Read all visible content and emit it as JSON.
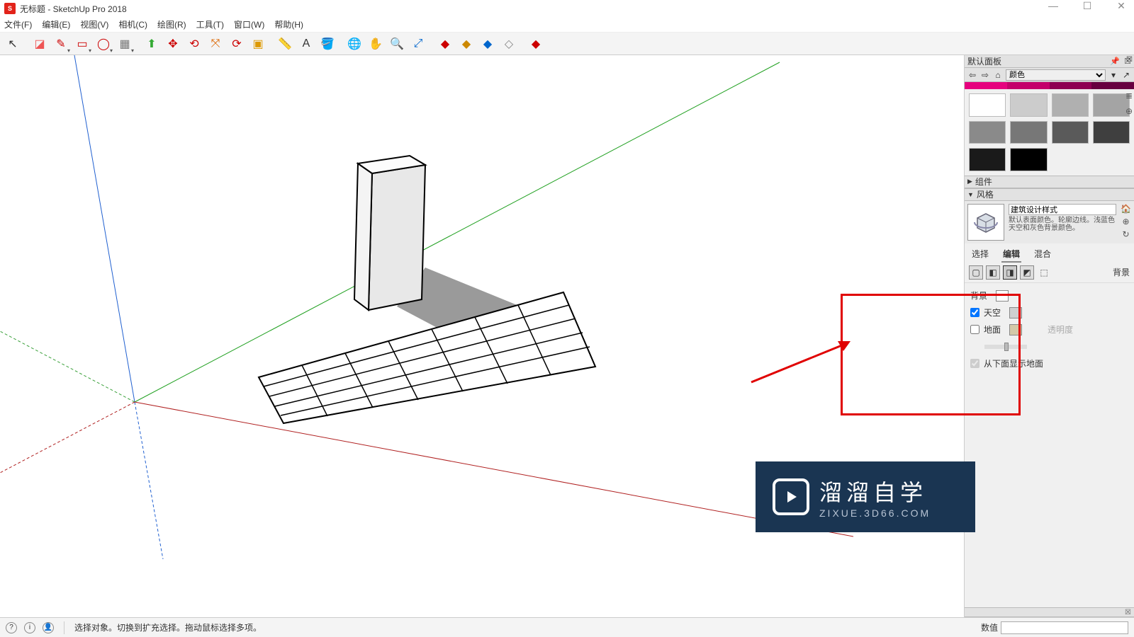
{
  "window": {
    "title": "无标题 - SketchUp Pro 2018"
  },
  "menu": [
    "文件(F)",
    "编辑(E)",
    "视图(V)",
    "相机(C)",
    "绘图(R)",
    "工具(T)",
    "窗口(W)",
    "帮助(H)"
  ],
  "tools": [
    {
      "name": "select-tool",
      "emoji": "↖",
      "interact": true
    },
    {
      "sep": true
    },
    {
      "name": "eraser-tool",
      "emoji": "◪",
      "interact": true,
      "color": "#e55"
    },
    {
      "name": "pencil-tool",
      "emoji": "✎",
      "interact": true,
      "drop": true,
      "color": "#c00"
    },
    {
      "name": "rectangle-tool",
      "emoji": "▭",
      "interact": true,
      "drop": true,
      "color": "#c00"
    },
    {
      "name": "circle-tool",
      "emoji": "◯",
      "interact": true,
      "drop": true,
      "color": "#c00"
    },
    {
      "name": "paint-tool",
      "emoji": "▦",
      "interact": true,
      "drop": true,
      "color": "#777"
    },
    {
      "sep": true
    },
    {
      "name": "pushpull-tool",
      "emoji": "⬆",
      "interact": true,
      "color": "#3a3"
    },
    {
      "name": "move-tool",
      "emoji": "✥",
      "interact": true,
      "color": "#c00"
    },
    {
      "name": "rotate-tool",
      "emoji": "⟲",
      "interact": true,
      "color": "#c00"
    },
    {
      "name": "scale-tool",
      "emoji": "⤧",
      "interact": true,
      "color": "#d60"
    },
    {
      "name": "offset-tool",
      "emoji": "⟳",
      "interact": true,
      "color": "#c00"
    },
    {
      "name": "followme-tool",
      "emoji": "▣",
      "interact": true,
      "color": "#d90"
    },
    {
      "sep": true
    },
    {
      "name": "tape-tool",
      "emoji": "📏",
      "interact": true,
      "color": "#cc0"
    },
    {
      "name": "text-tool",
      "emoji": "A",
      "interact": true,
      "color": "#333"
    },
    {
      "name": "paint-bucket",
      "emoji": "🪣",
      "interact": true,
      "color": "#a70"
    },
    {
      "sep": true
    },
    {
      "name": "orbit-tool",
      "emoji": "🌐",
      "interact": true,
      "color": "#06c"
    },
    {
      "name": "pan-tool",
      "emoji": "✋",
      "interact": true,
      "color": "#da5"
    },
    {
      "name": "zoom-tool",
      "emoji": "🔍",
      "interact": true
    },
    {
      "name": "zoom-extents",
      "emoji": "⤢",
      "interact": true,
      "color": "#06c"
    },
    {
      "sep": true
    },
    {
      "name": "add-tool-1",
      "emoji": "◆",
      "interact": true,
      "color": "#c00"
    },
    {
      "name": "add-tool-2",
      "emoji": "◆",
      "interact": true,
      "color": "#c80"
    },
    {
      "name": "add-tool-3",
      "emoji": "◆",
      "interact": true,
      "color": "#06c"
    },
    {
      "name": "add-tool-4",
      "emoji": "◇",
      "interact": true,
      "color": "#888"
    },
    {
      "sep": true
    },
    {
      "name": "add-tool-5",
      "emoji": "◆",
      "interact": true,
      "color": "#c00"
    }
  ],
  "right_panel": {
    "header": "默认面板",
    "materials": {
      "dropdown": "颜色"
    },
    "swatch_colors_strip": [
      "#e6007e",
      "#c4006a",
      "#8e0052",
      "#670040"
    ],
    "swatch_grid": [
      "#ffffff",
      "#cccccc",
      "#b0b0b0",
      "#a4a4a4",
      "#8a8a8a",
      "#777777",
      "#5a5a5a",
      "#3f3f3f",
      "#1a1a1a",
      "#000000"
    ],
    "sections": {
      "component": "组件",
      "style": "风格"
    },
    "style": {
      "name": "建筑设计样式",
      "desc": "默认表面颜色。轮廓边线。浅蓝色天空和灰色背景颜色。"
    },
    "style_tabs": {
      "select": "选择",
      "edit": "编辑",
      "mix": "混合",
      "active": "edit"
    },
    "bg_label_right": "背景",
    "bg": {
      "background_label": "背景",
      "background_color": "#ffffff",
      "sky_label": "天空",
      "sky_checked": true,
      "sky_color": "#cfcfcf",
      "ground_label": "地面",
      "ground_checked": false,
      "ground_color": "#d4c9a8",
      "transp_label": "透明度",
      "show_ground_below": "从下面显示地面",
      "show_ground_below_checked": true
    }
  },
  "status": {
    "hint": "选择对象。切换到扩充选择。拖动鼠标选择多项。",
    "value_label": "数值"
  },
  "watermark": {
    "line1": "溜溜自学",
    "line2": "ZIXUE.3D66.COM"
  }
}
